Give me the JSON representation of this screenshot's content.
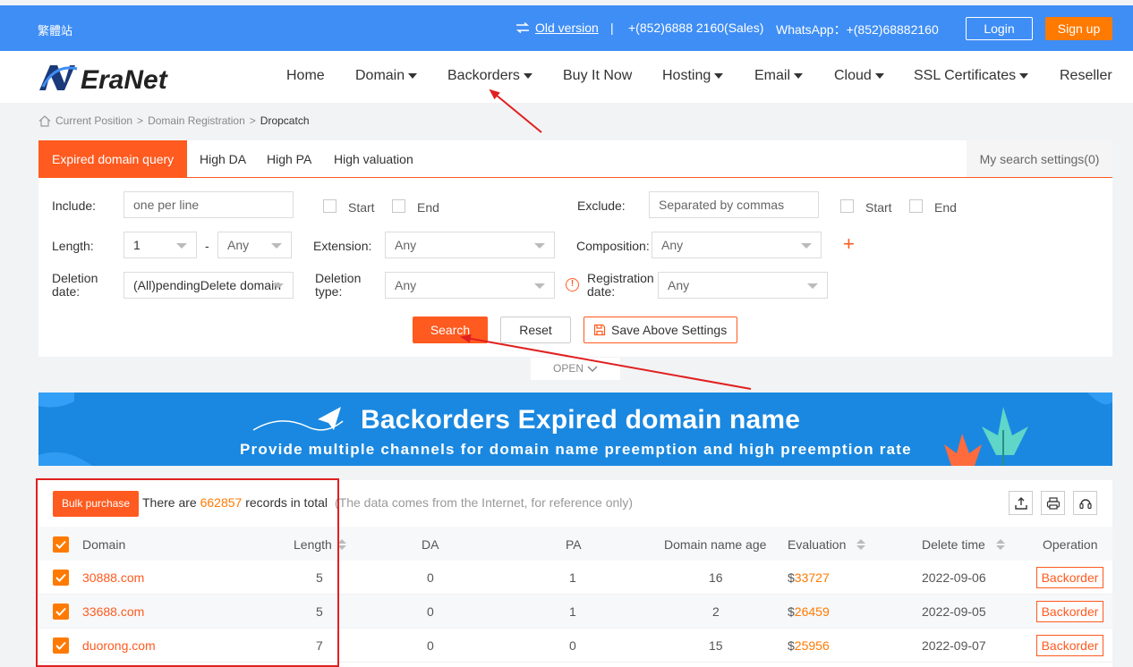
{
  "topbar": {
    "traditional": "繁體站",
    "old_version": "Old version",
    "separator": "|",
    "phone": "+(852)6888 2160(Sales)",
    "whatsapp": "WhatsApp：+(852)68882160",
    "login": "Login",
    "signup": "Sign up"
  },
  "brand": {
    "name": "EraNet"
  },
  "nav": {
    "items": [
      "Home",
      "Domain",
      "Backorders",
      "Buy It Now",
      "Hosting",
      "Email",
      "Cloud",
      "SSL Certificates",
      "Reseller"
    ]
  },
  "breadcrumb": {
    "current_position": "Current Position",
    "sep": ">",
    "level1": "Domain Registration",
    "level2": "Dropcatch"
  },
  "tabs": {
    "items": [
      "Expired domain query",
      "High DA",
      "High PA",
      "High valuation"
    ],
    "settings": "My search settings(0)"
  },
  "filters": {
    "include_label": "Include:",
    "include_placeholder": "one per line",
    "start": "Start",
    "end": "End",
    "exclude_label": "Exclude:",
    "exclude_placeholder": "Separated by commas",
    "length_label": "Length:",
    "length_min": "1",
    "dash": "-",
    "length_max": "Any",
    "extension_label": "Extension:",
    "extension_value": "Any",
    "composition_label": "Composition:",
    "composition_value": "Any",
    "deletion_date_label_1": "Deletion",
    "deletion_date_label_2": "date:",
    "deletion_date_value": "(All)pendingDelete domain",
    "deletion_type_label_1": "Deletion",
    "deletion_type_label_2": "type:",
    "deletion_type_value": "Any",
    "registration_date_label_1": "Registration",
    "registration_date_label_2": "date:",
    "registration_date_value": "Any"
  },
  "actions": {
    "search": "Search",
    "reset": "Reset",
    "save": "Save Above Settings",
    "open": "OPEN"
  },
  "banner": {
    "title": "Backorders Expired domain name",
    "subtitle": "Provide multiple channels for domain name preemption and high preemption rate"
  },
  "results": {
    "bulk": "Bulk purchase",
    "prefix": "There are",
    "total": "662857",
    "suffix": "records in total",
    "note": "(The data comes from the Internet, for reference only)",
    "columns": [
      "Domain",
      "Length",
      "DA",
      "PA",
      "Domain name age",
      "Evaluation",
      "Delete time",
      "Operation"
    ],
    "rows": [
      {
        "domain": "30888.com",
        "length": "5",
        "da": "0",
        "pa": "1",
        "age": "16",
        "currency": "$",
        "evaluation": "33727",
        "delete_time": "2022-09-06",
        "op": "Backorder"
      },
      {
        "domain": "33688.com",
        "length": "5",
        "da": "0",
        "pa": "1",
        "age": "2",
        "currency": "$",
        "evaluation": "26459",
        "delete_time": "2022-09-05",
        "op": "Backorder"
      },
      {
        "domain": "duorong.com",
        "length": "7",
        "da": "0",
        "pa": "0",
        "age": "15",
        "currency": "$",
        "evaluation": "25956",
        "delete_time": "2022-09-07",
        "op": "Backorder"
      }
    ]
  },
  "colors": {
    "primary_blue": "#3f8ef5",
    "accent_orange": "#ff5a1f",
    "signup_orange": "#ff7a00",
    "annotation_red": "#e02020"
  }
}
